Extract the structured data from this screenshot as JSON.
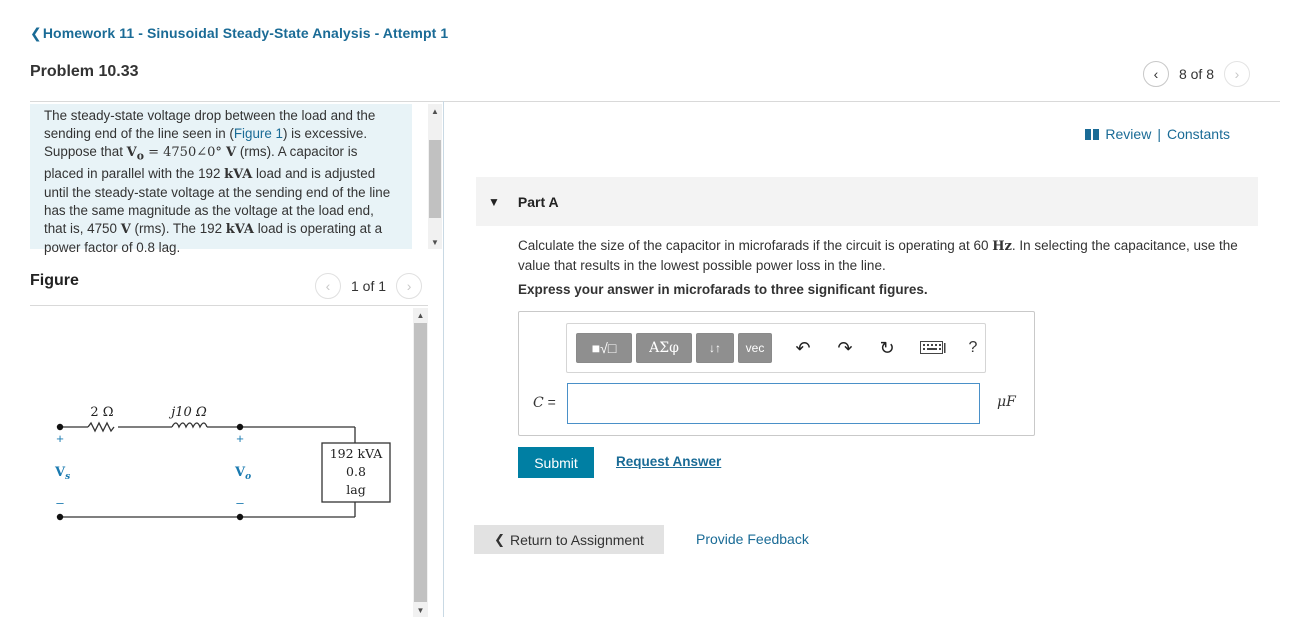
{
  "header": {
    "breadcrumb": "Homework 11 - Sinusoidal Steady-State Analysis - Attempt 1",
    "problem_title": "Problem 10.33",
    "pager_text": "8 of 8"
  },
  "intro": {
    "t1": "The steady-state voltage drop between the load and the sending end of the line seen in (",
    "figure_link": "Figure 1",
    "t2": ") is excessive. Suppose that ",
    "vo_sym": "V",
    "vo_sub": "o",
    "t3": " = 4750∠0° ",
    "v_unit": "V",
    "t4": " (rms). A capacitor is placed in parallel with the 192 ",
    "kva1": "kVA",
    "t5": " load and is adjusted until the steady-state voltage at the sending end of the line has the same magnitude as the voltage at the load end, that is, 4750 ",
    "v_unit2": "V",
    "t6": " (rms). The 192 ",
    "kva2": "kVA",
    "t7": " load is operating at a power factor of 0.8 lag."
  },
  "figure": {
    "label": "Figure",
    "pager_text": "1 of 1",
    "r_label": "2 Ω",
    "x_label": "j10 Ω",
    "vs_label": "V",
    "vs_sub": "s",
    "vo_label": "V",
    "vo_sub": "o",
    "plus": "+",
    "minus": "–",
    "load_line1": "192 kVA",
    "load_line2": "0.8",
    "load_line3": "lag"
  },
  "links": {
    "review": "Review",
    "separator": "|",
    "constants": "Constants"
  },
  "part": {
    "label": "Part A",
    "question_1": "Calculate the size of the capacitor in microfarads if the circuit is operating at 60 ",
    "question_hz": "Hz",
    "question_2": ". In selecting the capacitance, use the value that results in the lowest possible power loss in the line.",
    "instruction": "Express your answer in microfarads to three significant figures."
  },
  "toolbar": {
    "templates": "■√□",
    "greek": "ΑΣφ",
    "arrows": "↓↑",
    "vec": "vec",
    "help": "?"
  },
  "answer": {
    "var_label": "C",
    "equals": " =",
    "value": "",
    "unit": "μF"
  },
  "actions": {
    "submit": "Submit",
    "request": "Request Answer",
    "return": "Return to Assignment",
    "feedback": "Provide Feedback"
  }
}
